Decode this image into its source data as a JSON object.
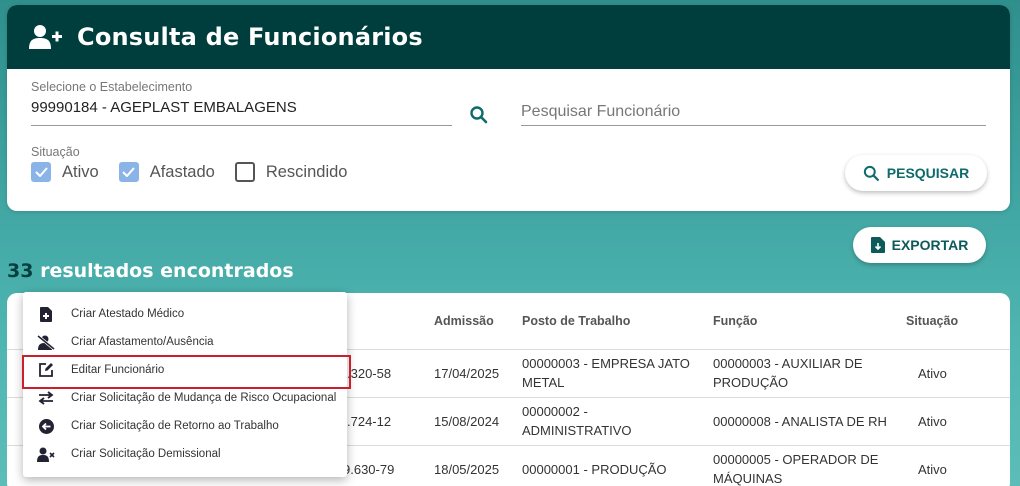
{
  "header": {
    "title": "Consulta de Funcionários",
    "icon": "add-user-icon"
  },
  "filters": {
    "establishment_label": "Selecione o Estabelecimento",
    "establishment_value": "99990184 - AGEPLAST EMBALAGENS",
    "employee_placeholder": "Pesquisar Funcionário",
    "situation_label": "Situação",
    "situations": [
      {
        "label": "Ativo",
        "checked": true
      },
      {
        "label": "Afastado",
        "checked": true
      },
      {
        "label": "Rescindido",
        "checked": false
      }
    ],
    "search_button": "PESQUISAR"
  },
  "export_button": "EXPORTAR",
  "results": {
    "count": "33",
    "label": "resultados encontrados"
  },
  "table": {
    "headers": [
      "Admissão",
      "Posto de Trabalho",
      "Função",
      "Situação"
    ],
    "rows": [
      {
        "doc": ".320-58",
        "admissao": "17/04/2025",
        "posto_1": "00000003 - EMPRESA JATO",
        "posto_2": "METAL",
        "funcao_1": "00000003 - AUXILIAR DE",
        "funcao_2": "PRODUÇÃO",
        "situacao": "Ativo"
      },
      {
        "doc": ".724-12",
        "admissao": "15/08/2024",
        "posto_1": "00000002 -",
        "posto_2": "ADMINISTRATIVO",
        "funcao_1": "00000008 - ANALISTA DE RH",
        "funcao_2": "",
        "situacao": "Ativo"
      },
      {
        "doc": "9.630-79",
        "admissao": "18/05/2025",
        "posto_1": "00000001 - PRODUÇÃO",
        "posto_2": "",
        "funcao_1": "00000005 - OPERADOR DE",
        "funcao_2": "MÁQUINAS",
        "situacao": "Ativo"
      }
    ]
  },
  "context_menu": {
    "items": [
      {
        "label": "Criar Atestado Médico",
        "icon": "medical-file-icon"
      },
      {
        "label": "Criar Afastamento/Ausência",
        "icon": "user-slash-icon"
      },
      {
        "label": "Editar Funcionário",
        "icon": "edit-icon",
        "highlighted": true
      },
      {
        "label": "Criar Solicitação de Mudança de Risco Ocupacional",
        "icon": "swap-arrows-icon"
      },
      {
        "label": "Criar Solicitação de Retorno ao Trabalho",
        "icon": "arrow-left-circle-icon"
      },
      {
        "label": "Criar Solicitação Demissional",
        "icon": "user-remove-icon"
      }
    ]
  },
  "colors": {
    "header_bg": "#003d3d",
    "accent": "#0e6b6b",
    "checkbox_checked": "#8ab4e8",
    "highlight_border": "#cc1f2d"
  }
}
